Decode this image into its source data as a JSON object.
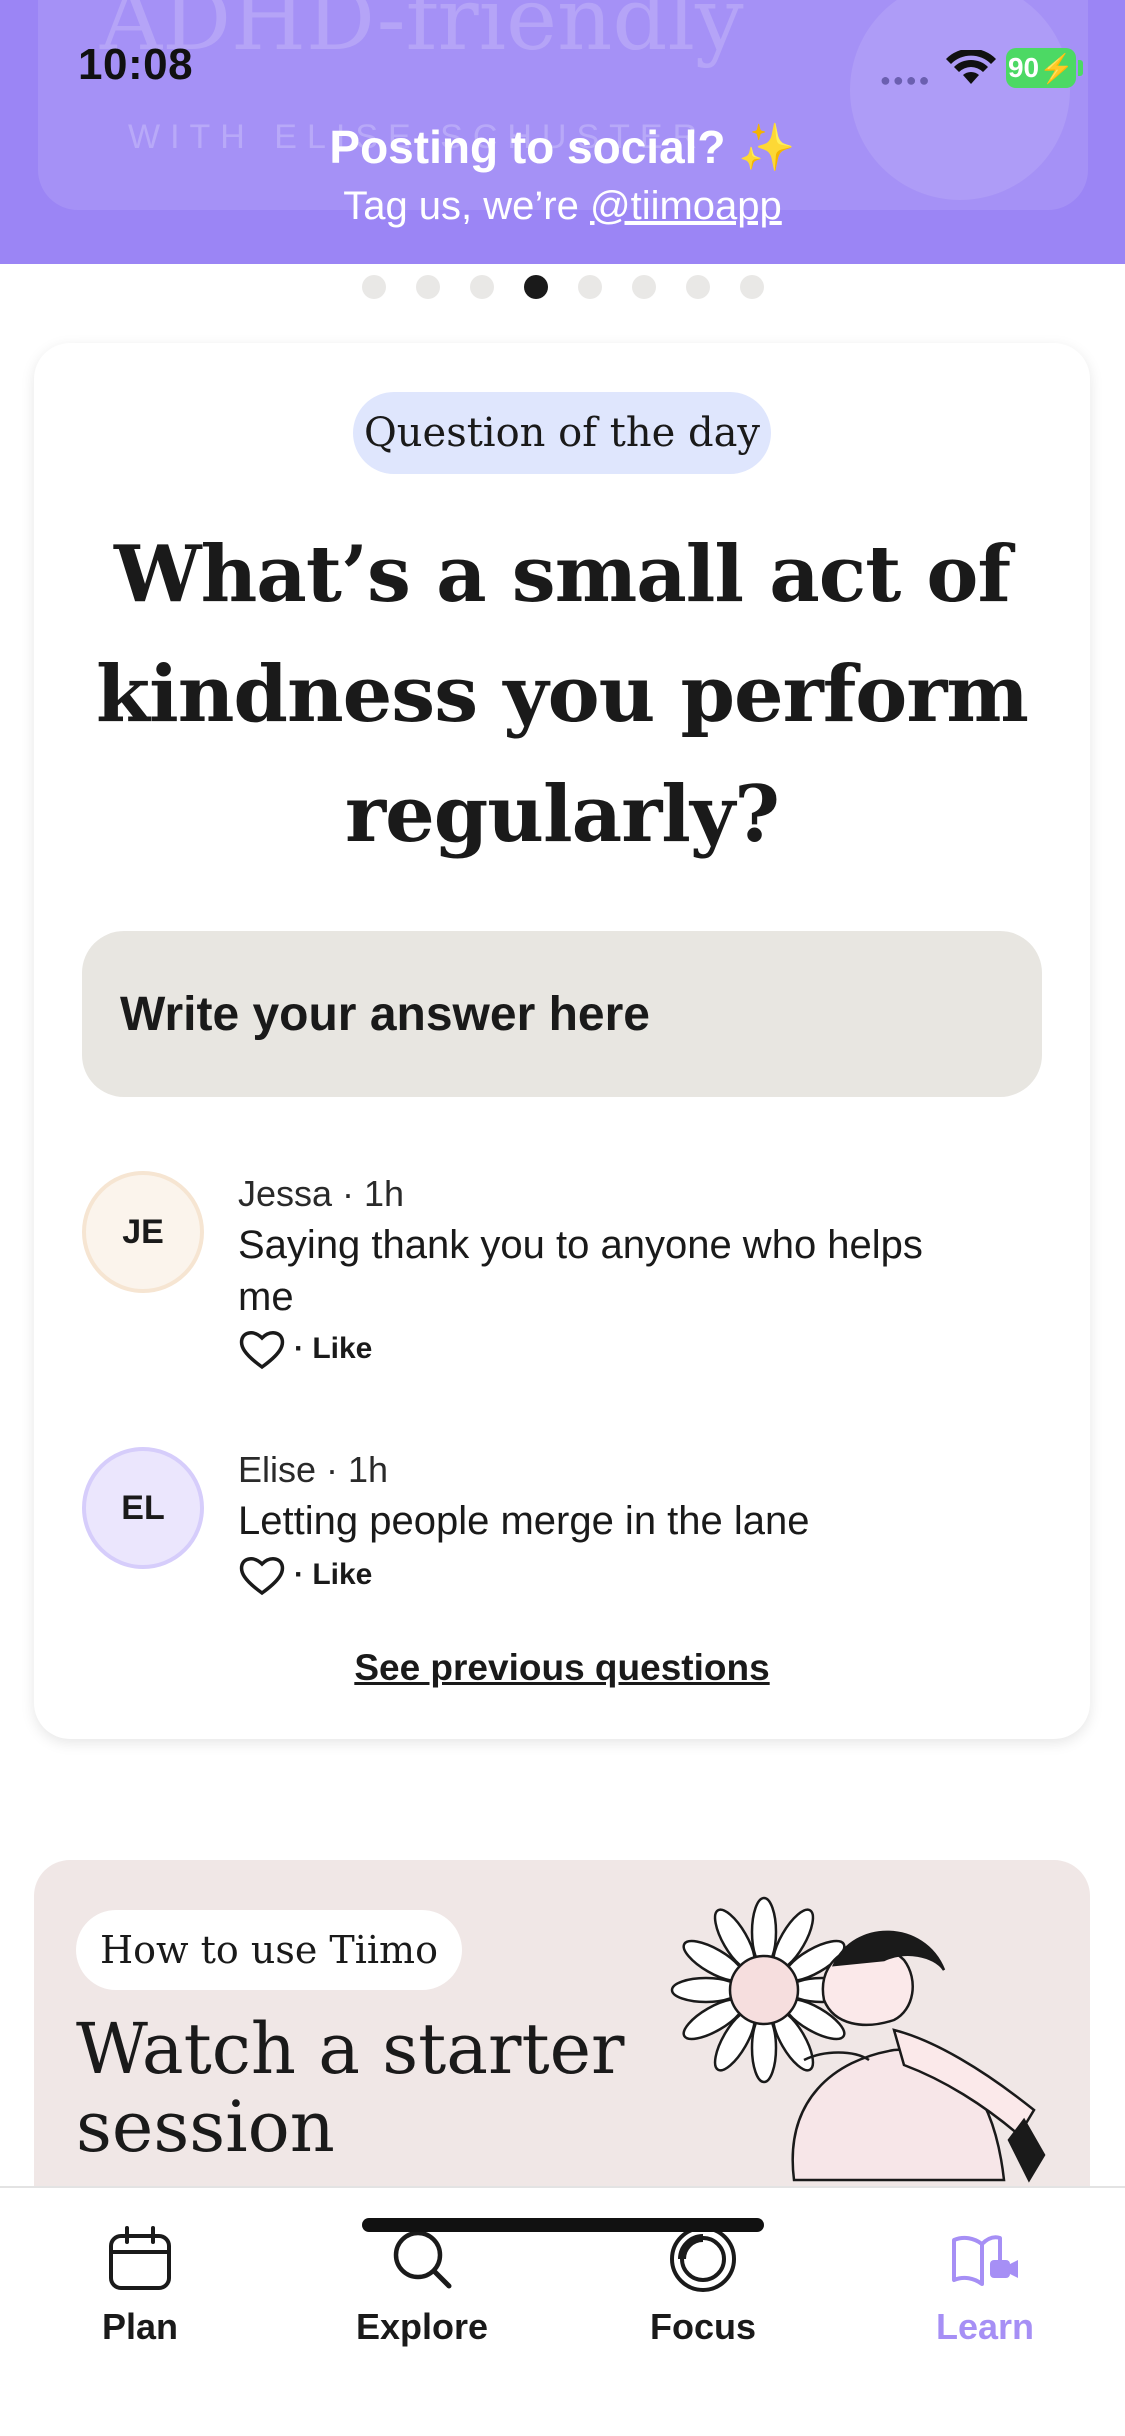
{
  "status_bar": {
    "time": "10:08",
    "battery": "90"
  },
  "banner": {
    "ghost_title": "ADHD-friendly",
    "ghost_subtitle": "WITH ELISE SCHUSTER",
    "title": "Posting to social? ✨",
    "subtitle_prefix": "Tag us, we’re ",
    "handle": "@tiimoapp",
    "background": "#9b85f5"
  },
  "pager": {
    "count": 8,
    "active_index": 3
  },
  "question_card": {
    "pill": "Question of the day",
    "title": "What’s a small act of kindness you perform regularly?",
    "answer_placeholder": "Write your answer here",
    "comments": [
      {
        "initials": "JE",
        "author": "Jessa",
        "time": "1h",
        "meta": "Jessa · 1h",
        "text": "Saying thank you to anyone who helps me",
        "like_label": "· Like"
      },
      {
        "initials": "EL",
        "author": "Elise",
        "time": "1h",
        "meta": "Elise · 1h",
        "text": "Letting people merge in the lane",
        "like_label": "· Like"
      }
    ],
    "see_previous": "See previous questions"
  },
  "starter_card": {
    "pill": "How to use Tiimo",
    "title": "Watch a starter session"
  },
  "tabbar": {
    "tabs": [
      {
        "label": "Plan",
        "icon": "calendar-icon",
        "active": false
      },
      {
        "label": "Explore",
        "icon": "search-icon",
        "active": false
      },
      {
        "label": "Focus",
        "icon": "focus-icon",
        "active": false
      },
      {
        "label": "Learn",
        "icon": "book-video-icon",
        "active": true
      }
    ],
    "accent": "#a68ff5"
  }
}
